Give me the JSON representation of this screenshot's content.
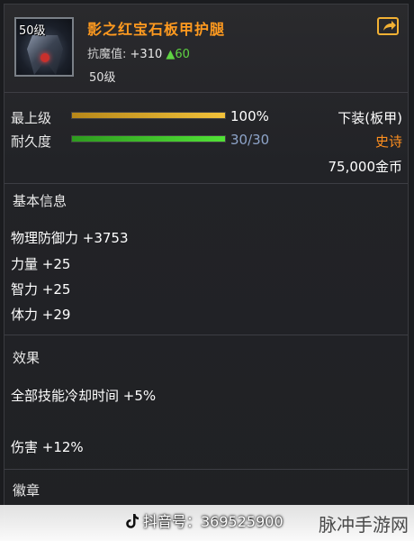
{
  "item": {
    "level_badge": "50级",
    "name": "影之红宝石板甲护腿",
    "enchant_label": "抗魔值:",
    "enchant_value": "+310",
    "enchant_bonus": "▲60",
    "level_text": "50级"
  },
  "bars": {
    "max_label": "最上级",
    "max_value": "100%",
    "max_fraction": 1.0,
    "durability_label": "耐久度",
    "durability_value": "30/30",
    "durability_fraction": 1.0
  },
  "meta": {
    "type": "下装(板甲)",
    "quality": "史诗",
    "price": "75,000金币"
  },
  "basic_info": {
    "title": "基本信息",
    "attributes": [
      "物理防御力 +3753",
      "力量 +25",
      "智力 +25",
      "体力 +29"
    ]
  },
  "effects": {
    "title": "效果",
    "lines": [
      "全部技能冷却时间 +5%",
      "伤害 +12%"
    ]
  },
  "badge_section": {
    "title": "徽章"
  },
  "watermark": {
    "douyin": "抖音号：369525900",
    "site": "脉冲手游网"
  },
  "colors": {
    "name": "#ff9a1f",
    "quality": "#ff8f1f",
    "bonus_green": "#5fd443",
    "bar_gold": "#f2c23a",
    "bar_green": "#51e236"
  },
  "icons": {
    "share": "share-icon",
    "item": "leg-armor-icon",
    "tiktok": "tiktok-logo-icon"
  }
}
